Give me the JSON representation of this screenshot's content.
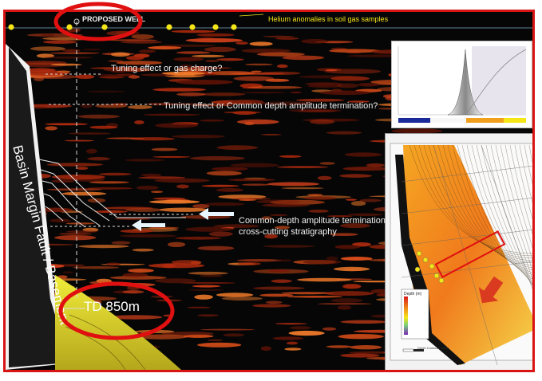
{
  "labels": {
    "proposed_well": "PROPOSED WELL",
    "helium_anomalies": "Helium anomalies in soil gas samples",
    "tuning_gas": "Tuning effect or gas charge?",
    "tuning_common": "Tuning effect or Common depth amplitude termination?",
    "common_depth_line1": "Common-depth amplitude terminations,",
    "common_depth_line2": "cross-cutting stratigraphy",
    "td": "TD 850m",
    "fault": "Basin Margin Fault / Basement"
  },
  "inset_map": {
    "legend_title": "Depth (m)",
    "caption": "Depth Contours: 20 m"
  },
  "colors": {
    "frame": "#d81414",
    "highlight_ellipse": "#e01010",
    "helium_marker": "#f5e617",
    "arrow": "#d93a20",
    "seismic_amplitude": "#e0501a"
  }
}
